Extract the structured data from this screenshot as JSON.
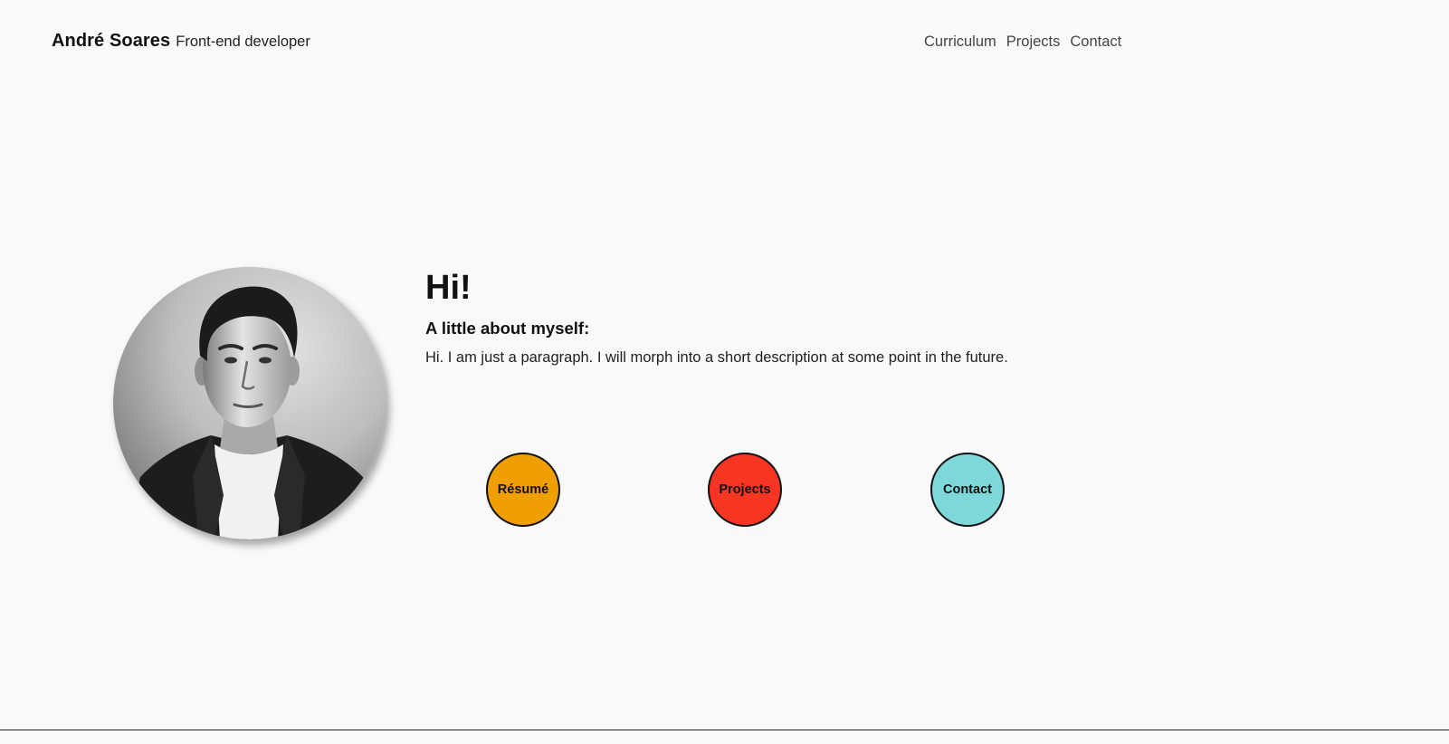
{
  "header": {
    "name": "André Soares",
    "role": "Front-end developer",
    "nav": [
      {
        "label": "Curriculum"
      },
      {
        "label": "Projects"
      },
      {
        "label": "Contact"
      }
    ]
  },
  "profile": {
    "photo_icon": "profile-photo"
  },
  "intro": {
    "greeting": "Hi!",
    "subheading": "A little about myself:",
    "description": "Hi. I am just a paragraph. I will morph into a short description at some point in the future."
  },
  "actions": [
    {
      "label": "Résumé",
      "color": "#ef9f00"
    },
    {
      "label": "Projects",
      "color": "#f63522"
    },
    {
      "label": "Contact",
      "color": "#7ed8da"
    }
  ]
}
